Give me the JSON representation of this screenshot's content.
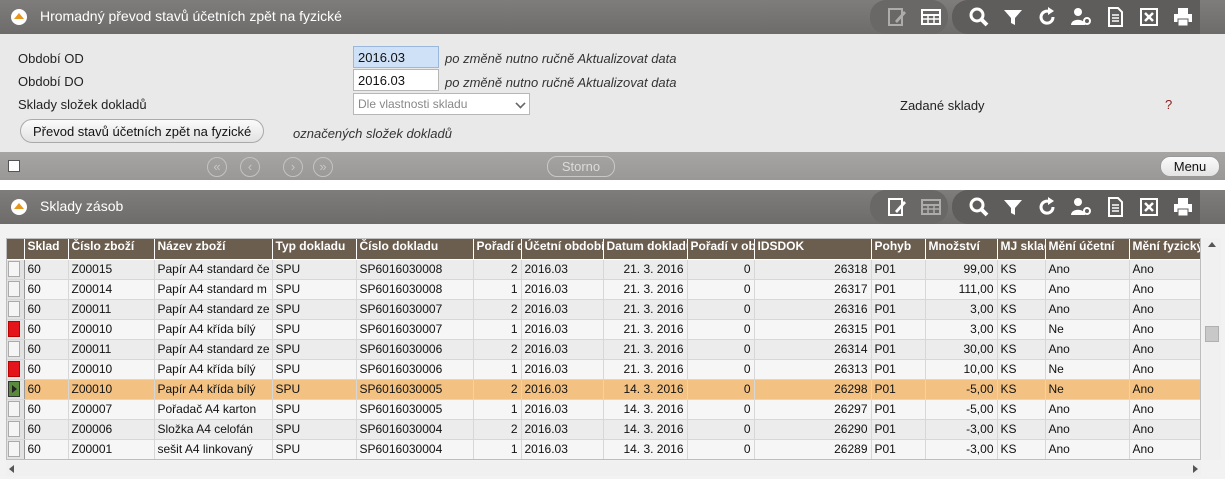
{
  "panel1": {
    "title": "Hromadný převod stavů účetních zpět na fyzické"
  },
  "form": {
    "obdobi_od_label": "Období OD",
    "obdobi_od_value": "2016.03",
    "obdobi_od_hint": "po změně nutno ručně Aktualizovat data",
    "obdobi_do_label": "Období DO",
    "obdobi_do_value": "2016.03",
    "obdobi_do_hint": "po změně nutno ručně Aktualizovat data",
    "sklady_label": "Sklady složek dokladů",
    "sklady_select_value": "Dle vlastnosti skladu",
    "zadane_sklady_label": "Zadané sklady",
    "zadane_sklady_value": "?",
    "prevod_button": "Převod stavů účetních zpět na fyzické",
    "prevod_hint": "označených složek dokladů"
  },
  "navbar": {
    "first": "«",
    "prev": "‹",
    "next": "›",
    "last": "»",
    "storno": "Storno",
    "menu": "Menu"
  },
  "panel2": {
    "title": "Sklady zásob"
  },
  "toolbar_icons": [
    "edit-icon",
    "table-icon",
    "search-icon",
    "filter-icon",
    "refresh-icon",
    "users-settings-icon",
    "document-icon",
    "excel-icon",
    "print-icon"
  ],
  "grid": {
    "columns": [
      "Sklad",
      "Číslo zboží",
      "Název zboží",
      "Typ dokladu",
      "Číslo dokladu",
      "Pořadí dokladu",
      "Účetní období",
      "Datum dokladu",
      "Pořadí v období",
      "IDSDOK",
      "Pohyb",
      "Množství",
      "MJ skladu",
      "Mění účetní",
      "Mění fyzický"
    ],
    "rows": [
      {
        "mark": "",
        "cells": [
          "60",
          "Z00015",
          "Papír A4 standard če",
          "SPU",
          "SP6016030008",
          "2",
          "2016.03",
          "21. 3. 2016",
          "0",
          "26318",
          "P01",
          "99,00",
          "KS",
          "Ano",
          "Ano"
        ]
      },
      {
        "mark": "",
        "cells": [
          "60",
          "Z00014",
          "Papír A4 standard m",
          "SPU",
          "SP6016030008",
          "1",
          "2016.03",
          "21. 3. 2016",
          "0",
          "26317",
          "P01",
          "111,00",
          "KS",
          "Ano",
          "Ano"
        ]
      },
      {
        "mark": "",
        "cells": [
          "60",
          "Z00011",
          "Papír A4 standard ze",
          "SPU",
          "SP6016030007",
          "2",
          "2016.03",
          "21. 3. 2016",
          "0",
          "26316",
          "P01",
          "3,00",
          "KS",
          "Ano",
          "Ano"
        ]
      },
      {
        "mark": "red",
        "cells": [
          "60",
          "Z00010",
          "Papír A4 křída bílý",
          "SPU",
          "SP6016030007",
          "1",
          "2016.03",
          "21. 3. 2016",
          "0",
          "26315",
          "P01",
          "3,00",
          "KS",
          "Ne",
          "Ano"
        ]
      },
      {
        "mark": "",
        "cells": [
          "60",
          "Z00011",
          "Papír A4 standard ze",
          "SPU",
          "SP6016030006",
          "2",
          "2016.03",
          "21. 3. 2016",
          "0",
          "26314",
          "P01",
          "30,00",
          "KS",
          "Ano",
          "Ano"
        ]
      },
      {
        "mark": "red",
        "cells": [
          "60",
          "Z00010",
          "Papír A4 křída bílý",
          "SPU",
          "SP6016030006",
          "1",
          "2016.03",
          "21. 3. 2016",
          "0",
          "26313",
          "P01",
          "10,00",
          "KS",
          "Ne",
          "Ano"
        ]
      },
      {
        "mark": "current",
        "cells": [
          "60",
          "Z00010",
          "Papír A4 křída bílý",
          "SPU",
          "SP6016030005",
          "2",
          "2016.03",
          "14. 3. 2016",
          "0",
          "26298",
          "P01",
          "-5,00",
          "KS",
          "Ne",
          "Ano"
        ]
      },
      {
        "mark": "",
        "cells": [
          "60",
          "Z00007",
          "Pořadač A4 karton",
          "SPU",
          "SP6016030005",
          "1",
          "2016.03",
          "14. 3. 2016",
          "0",
          "26297",
          "P01",
          "-5,00",
          "KS",
          "Ano",
          "Ano"
        ]
      },
      {
        "mark": "",
        "cells": [
          "60",
          "Z00006",
          "Složka A4 celofán",
          "SPU",
          "SP6016030004",
          "2",
          "2016.03",
          "14. 3. 2016",
          "0",
          "26290",
          "P01",
          "-3,00",
          "KS",
          "Ano",
          "Ano"
        ]
      },
      {
        "mark": "",
        "cells": [
          "60",
          "Z00001",
          "sešit A4 linkovaný",
          "SPU",
          "SP6016030004",
          "1",
          "2016.03",
          "14. 3. 2016",
          "0",
          "26289",
          "P01",
          "-3,00",
          "KS",
          "Ano",
          "Ano"
        ]
      }
    ]
  },
  "colors": {
    "header_bar": "#757371",
    "grid_header": "#6b5e4f",
    "selected_row": "#f3c283",
    "mark_red": "#e5141a",
    "collapse_arrow": "#e7971b"
  }
}
